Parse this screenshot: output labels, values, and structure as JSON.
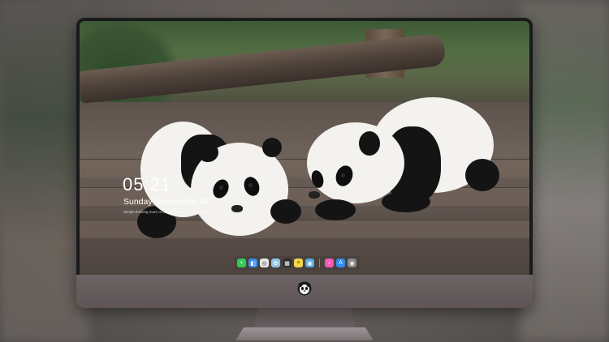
{
  "lock_screen": {
    "time": "05:21",
    "date": "Sunday September  28",
    "hint": "Simple thinking more of aims. Create your greetings"
  },
  "dock": {
    "items": [
      {
        "name": "messages-icon",
        "color": "#36c95a",
        "glyph": "💬"
      },
      {
        "name": "finder-icon",
        "color": "#3a8ef0",
        "glyph": "◧"
      },
      {
        "name": "safari-icon",
        "color": "#e9e9e9",
        "glyph": "◎"
      },
      {
        "name": "photos-icon",
        "color": "#8fc3e8",
        "glyph": "✿"
      },
      {
        "name": "clapper-icon",
        "color": "#2d2d2d",
        "glyph": "🎬"
      },
      {
        "name": "notes-icon",
        "color": "#f7d64a",
        "glyph": "≡"
      },
      {
        "name": "preview-icon",
        "color": "#5aa8e0",
        "glyph": "▣"
      },
      {
        "name": "music-icon",
        "color": "#f45ab4",
        "glyph": "♪"
      },
      {
        "name": "app-store-icon",
        "color": "#2f8cf2",
        "glyph": "A"
      },
      {
        "name": "camera-icon",
        "color": "#8c8c8c",
        "glyph": "◉"
      }
    ]
  },
  "colors": {
    "bezel": "#1a1a1c",
    "chin": "#6c6364",
    "text": "#ffffff"
  }
}
